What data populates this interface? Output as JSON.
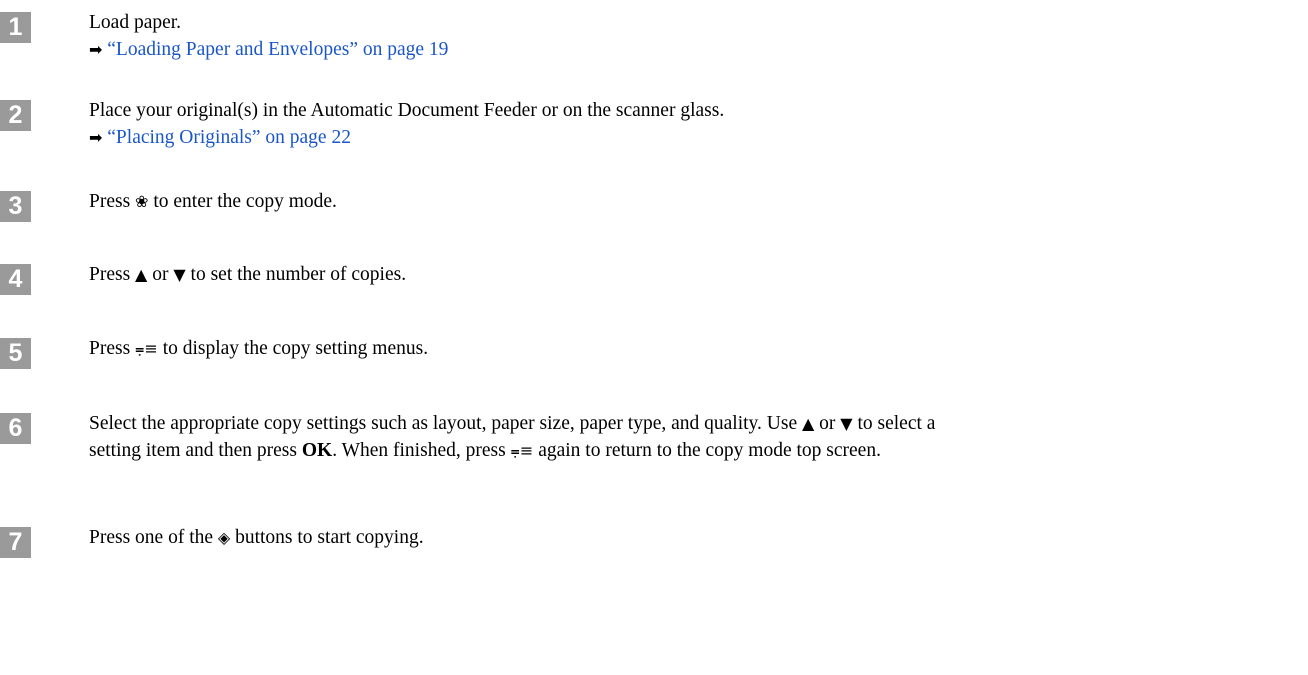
{
  "steps": [
    {
      "number": "1",
      "text": "Load paper.",
      "arrow": "➡",
      "link": "“Loading Paper and Envelopes” on page 19"
    },
    {
      "number": "2",
      "text": "Place your original(s) in the Automatic Document Feeder or on the scanner glass.",
      "arrow": "➡",
      "link": "“Placing Originals” on page 22"
    },
    {
      "number": "3",
      "pre": "Press ",
      "icon": "❀",
      "post": " to enter the copy mode."
    },
    {
      "number": "4",
      "pre": "Press ",
      "up": "▲",
      "mid": " or ",
      "down": "▼",
      "post": " to set the number of copies."
    },
    {
      "number": "5",
      "pre": "Press ",
      "icon": "⩦≡",
      "post": " to display the copy setting menus."
    },
    {
      "number": "6",
      "line1_pre": "Select the appropriate copy settings such as layout, paper size, paper type, and quality. Use ",
      "up": "▲",
      "mid": " or ",
      "down": "▼",
      "line1_post": " to select a",
      "line2_pre": "setting item and then press ",
      "ok": "OK",
      "line2_mid": ". When finished, press ",
      "icon": "⩦≡",
      "line2_post": " again to return to the copy mode top screen."
    },
    {
      "number": "7",
      "pre": "Press one of the ",
      "icon": "◈",
      "post": " buttons to start copying."
    }
  ]
}
